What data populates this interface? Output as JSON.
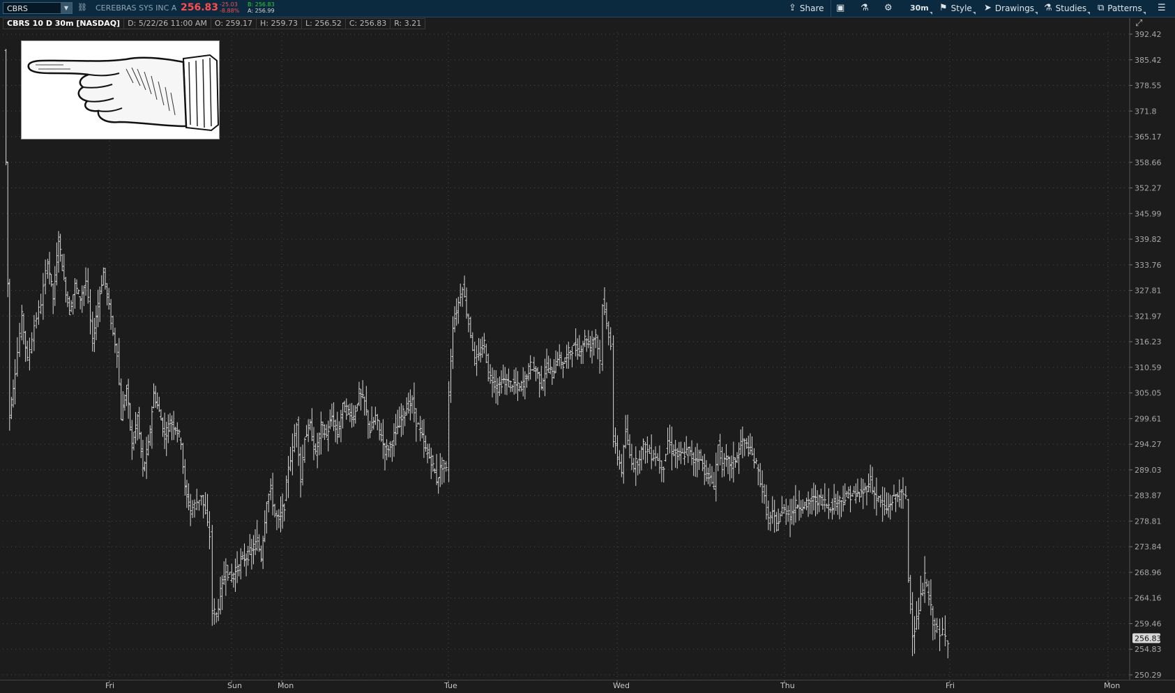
{
  "toolbar": {
    "symbol": "CBRS",
    "company": "CEREBRAS SYS INC A",
    "last_price": "256.83",
    "net_change": "-25.03",
    "pct_change": "-8.88%",
    "bid": "B: 256.83",
    "ask": "A: 256.99",
    "buttons": {
      "share": "Share",
      "timeframe": "30m",
      "style": "Style",
      "drawings": "Drawings",
      "studies": "Studies",
      "patterns": "Patterns"
    }
  },
  "info_bar": {
    "title": "CBRS 10 D 30m [NASDAQ]",
    "date": "D: 5/22/26 11:00 AM",
    "open": "O: 259.17",
    "high": "H: 259.73",
    "low": "L: 256.52",
    "close": "C: 256.83",
    "range": "R: 3.21"
  },
  "colors": {
    "background": "#1c1c1c",
    "bar": "#d8d8d8",
    "grid": "#4a4a4a",
    "toolbar": "#0b2a3f",
    "down": "#ff4d4d",
    "up": "#2fd12f"
  },
  "chart_data": {
    "type": "ohlc",
    "title": "CBRS 10 D 30m [NASDAQ]",
    "ylim": [
      250.29,
      392.42
    ],
    "y_ticks": [
      392.42,
      385.42,
      378.55,
      371.8,
      365.17,
      358.66,
      352.27,
      345.99,
      339.82,
      333.76,
      327.81,
      321.97,
      316.23,
      310.59,
      305.05,
      299.61,
      294.27,
      289.03,
      283.87,
      278.81,
      273.84,
      268.96,
      264.16,
      259.46,
      254.83,
      250.29
    ],
    "x_tick_labels": [
      "Fri",
      "Sun",
      "Mon",
      "Tue",
      "Wed",
      "Thu",
      "Fri",
      "Mon"
    ],
    "last_price_label": "256.83",
    "grid": true,
    "segments": [
      {
        "label": "Fri",
        "start": [
          0,
          388
        ],
        "points": [
          [
            8,
            300
          ],
          [
            16,
            310
          ],
          [
            26,
            322
          ],
          [
            34,
            312
          ],
          [
            44,
            320
          ],
          [
            54,
            325
          ],
          [
            64,
            335
          ],
          [
            72,
            326
          ],
          [
            80,
            340
          ],
          [
            88,
            330
          ],
          [
            96,
            323
          ],
          [
            104,
            329
          ],
          [
            112,
            326
          ],
          [
            120,
            330
          ],
          [
            130,
            316
          ],
          [
            138,
            325
          ],
          [
            146,
            332
          ],
          [
            154,
            324
          ],
          [
            160,
            318
          ],
          [
            166,
            314
          ],
          [
            172,
            300
          ],
          [
            180,
            306
          ],
          [
            188,
            294
          ],
          [
            196,
            300
          ],
          [
            204,
            289
          ],
          [
            212,
            294
          ],
          [
            220,
            305
          ],
          [
            228,
            301
          ],
          [
            236,
            296
          ],
          [
            244,
            299
          ],
          [
            252,
            298
          ],
          [
            260,
            295
          ],
          [
            266,
            285
          ],
          [
            274,
            281
          ],
          [
            280,
            282
          ],
          [
            290,
            284
          ],
          [
            296,
            280
          ],
          [
            302,
            276
          ]
        ]
      },
      {
        "label": "Sun-Mon",
        "start": [
          302,
          276
        ],
        "points": [
          [
            306,
            262
          ],
          [
            312,
            261
          ],
          [
            318,
            265
          ],
          [
            326,
            270
          ],
          [
            332,
            268
          ],
          [
            340,
            269
          ],
          [
            348,
            271
          ],
          [
            356,
            272
          ],
          [
            364,
            273
          ],
          [
            372,
            275
          ],
          [
            378,
            272
          ],
          [
            386,
            283
          ],
          [
            392,
            285
          ],
          [
            398,
            280
          ],
          [
            404,
            279
          ],
          [
            412,
            282
          ],
          [
            418,
            290
          ],
          [
            424,
            293
          ],
          [
            430,
            299
          ],
          [
            436,
            287
          ],
          [
            442,
            296
          ],
          [
            450,
            298
          ],
          [
            458,
            292
          ],
          [
            466,
            298
          ],
          [
            474,
            296
          ],
          [
            482,
            300
          ],
          [
            490,
            296
          ],
          [
            498,
            302
          ],
          [
            506,
            301
          ],
          [
            514,
            300
          ],
          [
            522,
            305
          ],
          [
            530,
            303
          ],
          [
            538,
            297
          ],
          [
            546,
            300
          ],
          [
            552,
            297
          ],
          [
            560,
            293
          ],
          [
            568,
            294
          ],
          [
            576,
            297
          ],
          [
            584,
            300
          ],
          [
            592,
            302
          ],
          [
            600,
            303
          ],
          [
            606,
            299
          ],
          [
            612,
            297
          ],
          [
            620,
            293
          ],
          [
            628,
            291
          ],
          [
            636,
            287
          ],
          [
            644,
            290
          ],
          [
            650,
            289
          ]
        ]
      },
      {
        "label": "Tue",
        "start": [
          650,
          289
        ],
        "points": [
          [
            654,
            305
          ],
          [
            660,
            320
          ],
          [
            668,
            325
          ],
          [
            674,
            329
          ],
          [
            680,
            323
          ],
          [
            686,
            318
          ],
          [
            692,
            312
          ],
          [
            698,
            313
          ],
          [
            706,
            316
          ],
          [
            712,
            309
          ],
          [
            718,
            308
          ],
          [
            726,
            306
          ],
          [
            734,
            308
          ],
          [
            742,
            307
          ],
          [
            750,
            307
          ],
          [
            758,
            306
          ],
          [
            766,
            308
          ],
          [
            774,
            311
          ],
          [
            782,
            310
          ],
          [
            790,
            307
          ],
          [
            798,
            311
          ],
          [
            806,
            309
          ],
          [
            814,
            313
          ],
          [
            822,
            311
          ],
          [
            830,
            314
          ],
          [
            838,
            315
          ],
          [
            846,
            314
          ],
          [
            854,
            317
          ],
          [
            862,
            315
          ],
          [
            870,
            318
          ],
          [
            876,
            312
          ],
          [
            880,
            325
          ],
          [
            886,
            320
          ],
          [
            892,
            316
          ]
        ]
      },
      {
        "label": "Wed",
        "start": [
          892,
          316
        ],
        "points": [
          [
            896,
            295
          ],
          [
            902,
            292
          ],
          [
            908,
            289
          ],
          [
            914,
            297
          ],
          [
            920,
            292
          ],
          [
            926,
            290
          ],
          [
            932,
            291
          ],
          [
            940,
            294
          ],
          [
            946,
            293
          ],
          [
            952,
            292
          ],
          [
            958,
            292
          ],
          [
            964,
            290
          ],
          [
            970,
            290
          ],
          [
            976,
            295
          ],
          [
            982,
            293
          ],
          [
            990,
            292
          ],
          [
            998,
            292
          ],
          [
            1006,
            293
          ],
          [
            1014,
            291
          ],
          [
            1022,
            292
          ],
          [
            1030,
            289
          ],
          [
            1038,
            287
          ],
          [
            1044,
            286
          ],
          [
            1050,
            294
          ],
          [
            1056,
            290
          ],
          [
            1062,
            291
          ],
          [
            1070,
            290
          ],
          [
            1078,
            292
          ],
          [
            1086,
            295
          ],
          [
            1092,
            294
          ],
          [
            1100,
            292
          ],
          [
            1106,
            290
          ],
          [
            1112,
            287
          ],
          [
            1118,
            283
          ]
        ]
      },
      {
        "label": "Thu",
        "start": [
          1118,
          283
        ],
        "points": [
          [
            1124,
            279
          ],
          [
            1130,
            280
          ],
          [
            1136,
            278
          ],
          [
            1144,
            281
          ],
          [
            1150,
            281
          ],
          [
            1156,
            280
          ],
          [
            1164,
            282
          ],
          [
            1172,
            282
          ],
          [
            1180,
            282
          ],
          [
            1188,
            283
          ],
          [
            1196,
            283
          ],
          [
            1204,
            283
          ],
          [
            1210,
            282
          ],
          [
            1218,
            282
          ],
          [
            1226,
            283
          ],
          [
            1234,
            283
          ],
          [
            1242,
            284
          ],
          [
            1250,
            284
          ],
          [
            1258,
            284
          ],
          [
            1266,
            285
          ],
          [
            1274,
            287
          ],
          [
            1280,
            284
          ],
          [
            1286,
            283
          ],
          [
            1292,
            282
          ],
          [
            1298,
            281
          ],
          [
            1306,
            283
          ],
          [
            1314,
            284
          ],
          [
            1322,
            284
          ],
          [
            1326,
            283
          ]
        ]
      },
      {
        "label": "Fri",
        "start": [
          1326,
          283
        ],
        "points": [
          [
            1330,
            268
          ],
          [
            1336,
            258
          ],
          [
            1342,
            260
          ],
          [
            1348,
            264
          ],
          [
            1354,
            268
          ],
          [
            1360,
            264
          ],
          [
            1366,
            260
          ],
          [
            1372,
            258
          ],
          [
            1376,
            257
          ],
          [
            1380,
            258
          ],
          [
            1384,
            257
          ],
          [
            1388,
            256.83
          ]
        ]
      }
    ]
  }
}
